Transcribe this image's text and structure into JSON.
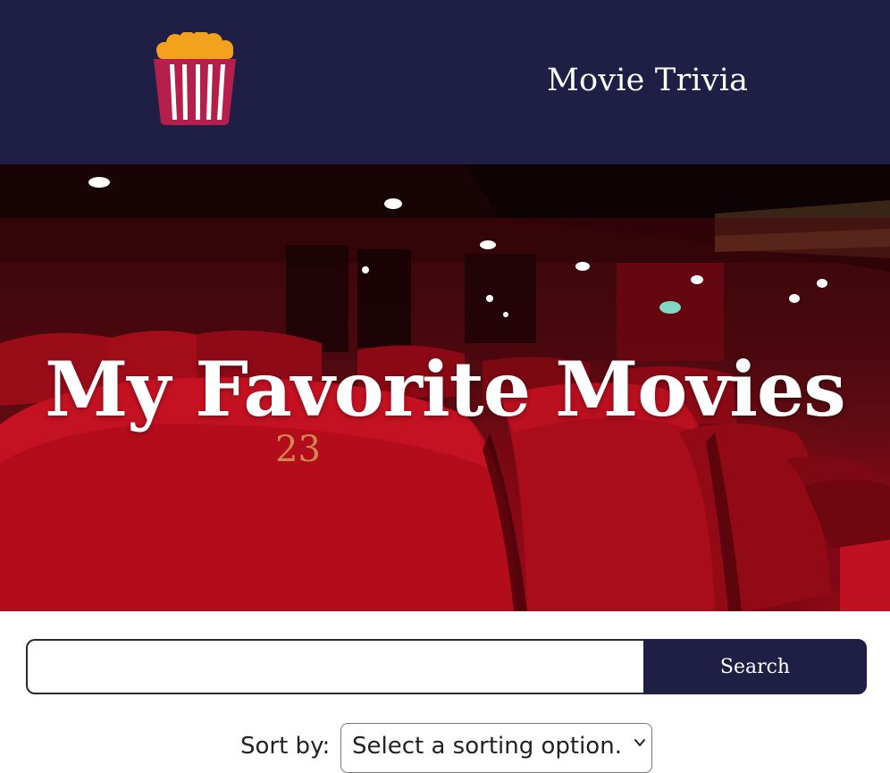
{
  "header": {
    "logo_icon": "popcorn-icon",
    "nav_link": "Movie Trivia",
    "background": "#1f1f45"
  },
  "hero": {
    "title": "My Favorite Movies",
    "seat_number": "23"
  },
  "search": {
    "value": "",
    "placeholder": "",
    "button_label": "Search"
  },
  "sort": {
    "label": "Sort by:",
    "selected_option": "Select a sorting option."
  },
  "colors": {
    "navy": "#1f1f45",
    "popcorn": "#f2a21d",
    "stripe": "#b51f4b"
  }
}
